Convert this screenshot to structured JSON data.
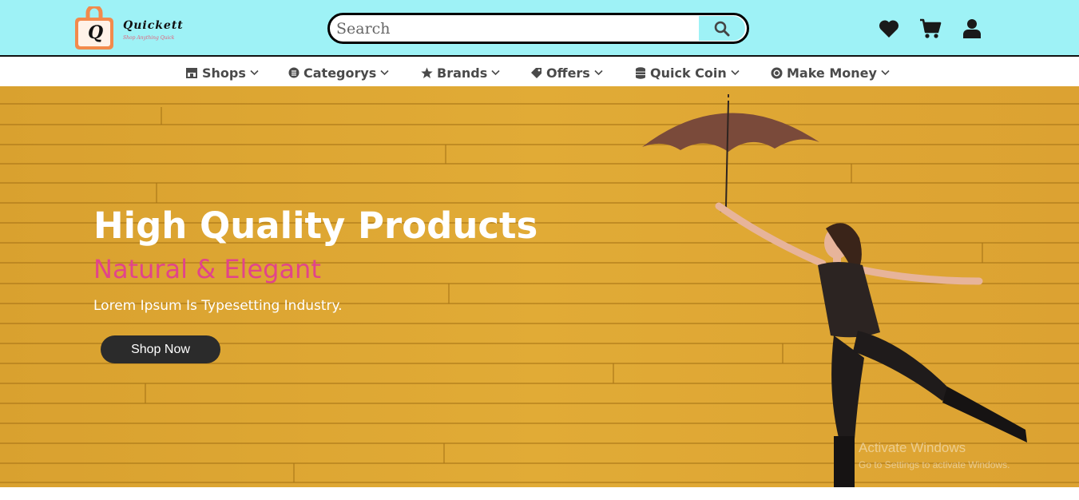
{
  "header": {
    "logo": {
      "brand": "Quickett",
      "tagline": "Shop Anything Quick",
      "mark_letter": "Q",
      "icon": "shopping-bag-icon"
    },
    "search": {
      "placeholder": "Search",
      "value": "",
      "icon": "search-icon"
    },
    "actions": [
      {
        "name": "wishlist",
        "icon": "heart-icon"
      },
      {
        "name": "cart",
        "icon": "cart-icon"
      },
      {
        "name": "account",
        "icon": "user-icon"
      }
    ]
  },
  "nav": {
    "items": [
      {
        "label": "Shops",
        "icon": "store-icon"
      },
      {
        "label": "Categorys",
        "icon": "list-icon"
      },
      {
        "label": "Brands",
        "icon": "star-icon"
      },
      {
        "label": "Offers",
        "icon": "tag-icon"
      },
      {
        "label": "Quick Coin",
        "icon": "coins-icon"
      },
      {
        "label": "Make Money",
        "icon": "money-icon"
      }
    ],
    "dropdown_icon": "chevron-down-icon"
  },
  "hero": {
    "title": "High Quality Products",
    "subtitle": "Natural & Elegant",
    "description": "Lorem Ipsum Is Typesetting Industry.",
    "button_label": "Shop Now"
  },
  "watermark": {
    "line1": "Activate Windows",
    "line2": "Go to Settings to activate Windows."
  },
  "colors": {
    "header_bg": "#9ef2f6",
    "hero_bg": "#dfa832",
    "subtitle": "#e2448a",
    "button_bg": "#2b2b2b",
    "logo_orange": "#f28a4c"
  }
}
